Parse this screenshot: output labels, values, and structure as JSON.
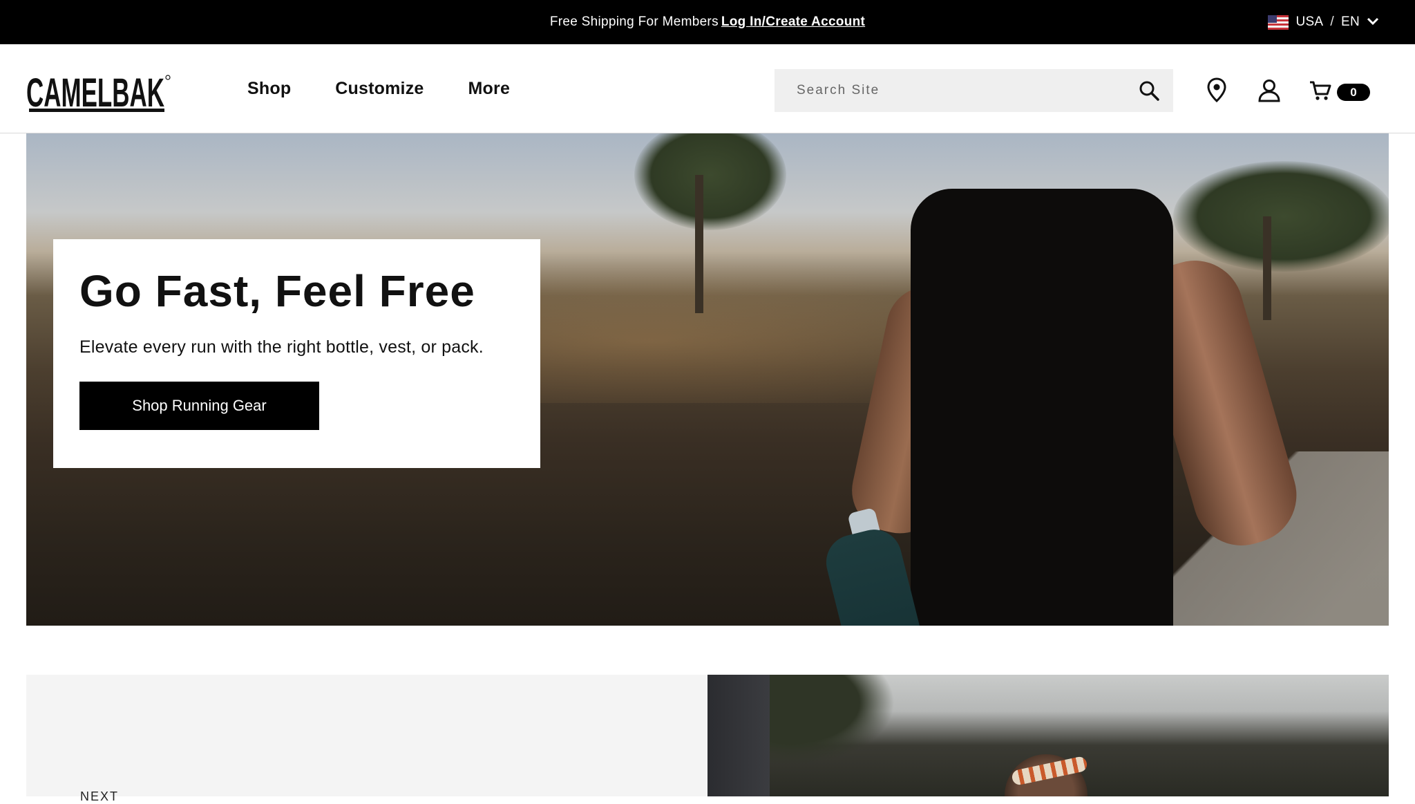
{
  "promo": {
    "text": "Free Shipping For Members",
    "link": "Log In/Create Account"
  },
  "locale": {
    "country": "USA",
    "separator": "/",
    "language": "EN",
    "flag_icon": "us-flag-icon"
  },
  "header": {
    "logo_text": "CAMELBAK",
    "nav": [
      "Shop",
      "Customize",
      "More"
    ],
    "search_placeholder": "Search Site",
    "cart_count": "0",
    "icons": [
      "search-icon",
      "location-pin-icon",
      "account-icon",
      "cart-icon"
    ]
  },
  "hero": {
    "title": "Go Fast, Feel Free",
    "subtitle": "Elevate every run with the right bottle, vest, or pack.",
    "cta": "Shop Running Gear"
  },
  "section2": {
    "label": "NEXT"
  },
  "colors": {
    "promo_bg": "#000000",
    "cta_bg": "#000000",
    "search_bg": "#efefef",
    "section_bg": "#f4f4f4"
  }
}
